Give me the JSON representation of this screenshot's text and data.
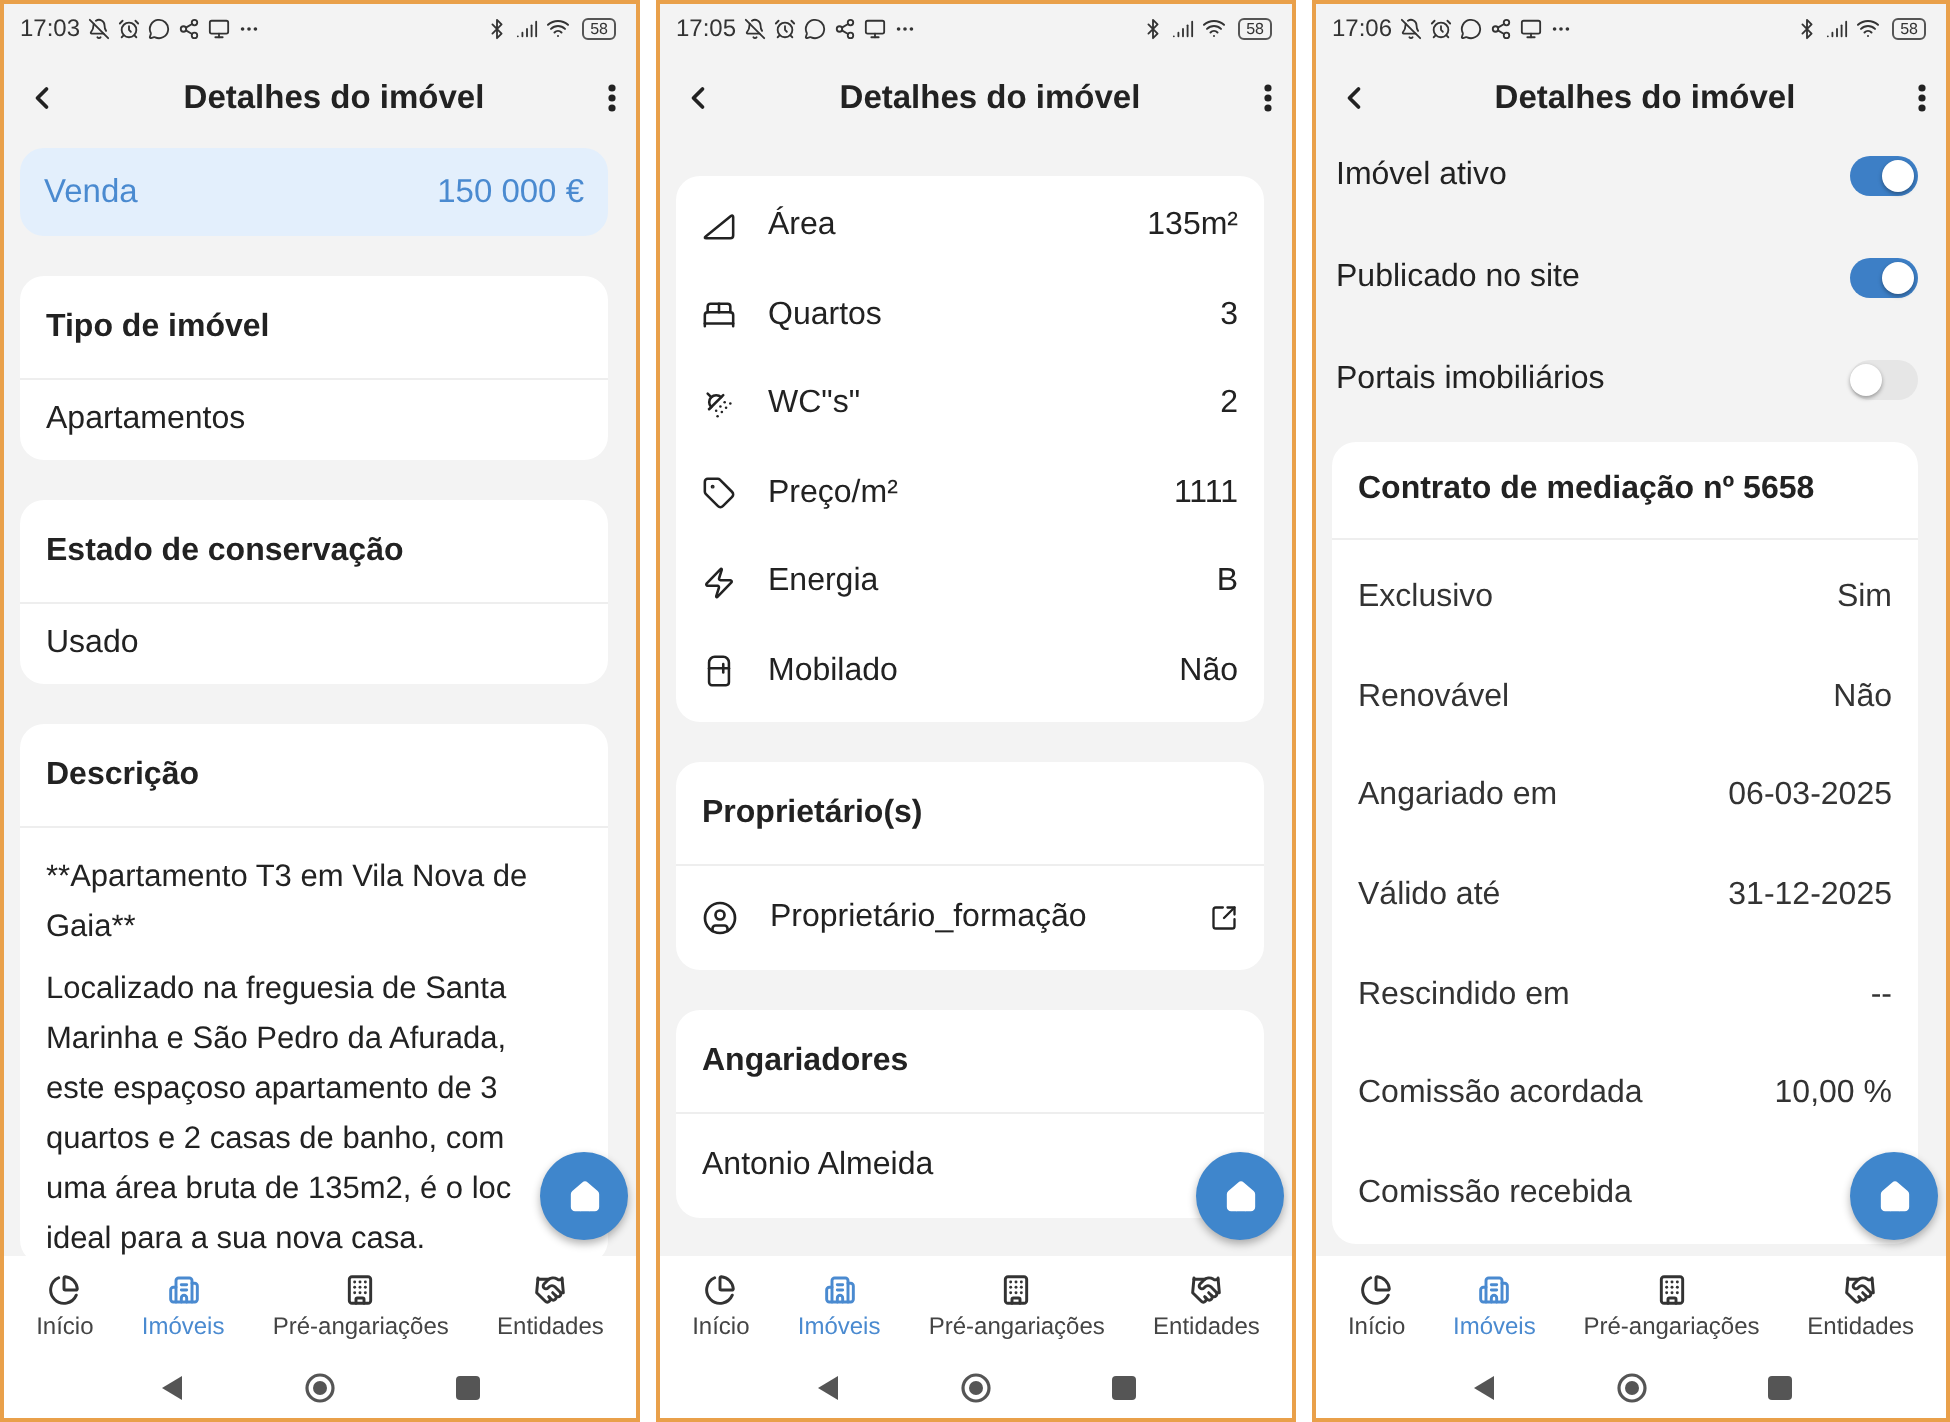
{
  "phones": [
    {
      "status": {
        "time": "17:03",
        "battery": "58"
      },
      "header": {
        "title": "Detalhes do imóvel"
      },
      "sections": [
        {
          "kind": "price",
          "label": "Venda",
          "value": "150 000 €"
        },
        {
          "kind": "card",
          "title": "Tipo de imóvel",
          "lines": [
            "Apartamentos"
          ]
        },
        {
          "kind": "card",
          "title": "Estado de conservação",
          "lines": [
            "Usado"
          ]
        },
        {
          "kind": "description",
          "title": "Descrição",
          "paragraphs": [
            [
              "**Apartamento T3 em Vila Nova de",
              "Gaia**"
            ],
            [
              "Localizado na freguesia de Santa",
              "Marinha e São Pedro da Afurada,",
              "este espaçoso apartamento de 3",
              "quartos e 2 casas de banho, com",
              "uma área bruta de 135m2, é o loc",
              "ideal para a sua nova casa."
            ]
          ]
        }
      ],
      "nav": [
        {
          "label": "Início",
          "selected": false
        },
        {
          "label": "Imóveis",
          "selected": true
        },
        {
          "label": "Pré-angariações",
          "selected": false
        },
        {
          "label": "Entidades",
          "selected": false
        }
      ]
    },
    {
      "status": {
        "time": "17:05",
        "battery": "58"
      },
      "header": {
        "title": "Detalhes do imóvel"
      },
      "sections": [
        {
          "kind": "features",
          "rows": [
            {
              "label": "Área",
              "value": "135m²"
            },
            {
              "label": "Quartos",
              "value": "3"
            },
            {
              "label": "WC\"s\"",
              "value": "2"
            },
            {
              "label": "Preço/m²",
              "value": "1111"
            },
            {
              "label": "Energia",
              "value": "B"
            },
            {
              "label": "Mobilado",
              "value": "Não"
            }
          ]
        },
        {
          "kind": "people",
          "title": "Proprietário(s)",
          "items": [
            {
              "name": "Proprietário_formação",
              "link": true
            }
          ]
        },
        {
          "kind": "people",
          "title": "Angariadores",
          "items": [
            {
              "name": "Antonio Almeida",
              "link": false
            }
          ]
        }
      ],
      "nav": [
        {
          "label": "Início",
          "selected": false
        },
        {
          "label": "Imóveis",
          "selected": true
        },
        {
          "label": "Pré-angariações",
          "selected": false
        },
        {
          "label": "Entidades",
          "selected": false
        }
      ]
    },
    {
      "status": {
        "time": "17:06",
        "battery": "58"
      },
      "header": {
        "title": "Detalhes do imóvel"
      },
      "sections": [
        {
          "kind": "toggle",
          "label": "Imóvel ativo",
          "on": true
        },
        {
          "kind": "toggle",
          "label": "Publicado no site",
          "on": true
        },
        {
          "kind": "toggle",
          "label": "Portais imobiliários",
          "on": false
        },
        {
          "kind": "contract",
          "title": "Contrato de mediação nº 5658",
          "rows": [
            {
              "label": "Exclusivo",
              "value": "Sim"
            },
            {
              "label": "Renovável",
              "value": "Não"
            },
            {
              "label": "Angariado em",
              "value": "06-03-2025"
            },
            {
              "label": "Válido até",
              "value": "31-12-2025"
            },
            {
              "label": "Rescindido em",
              "value": "--"
            },
            {
              "label": "Comissão acordada",
              "value": "10,00 %"
            },
            {
              "label": "Comissão recebida"
            }
          ]
        }
      ],
      "nav": [
        {
          "label": "Início",
          "selected": false
        },
        {
          "label": "Imóveis",
          "selected": true
        },
        {
          "label": "Pré-angariações",
          "selected": false
        },
        {
          "label": "Entidades",
          "selected": false
        }
      ]
    }
  ]
}
